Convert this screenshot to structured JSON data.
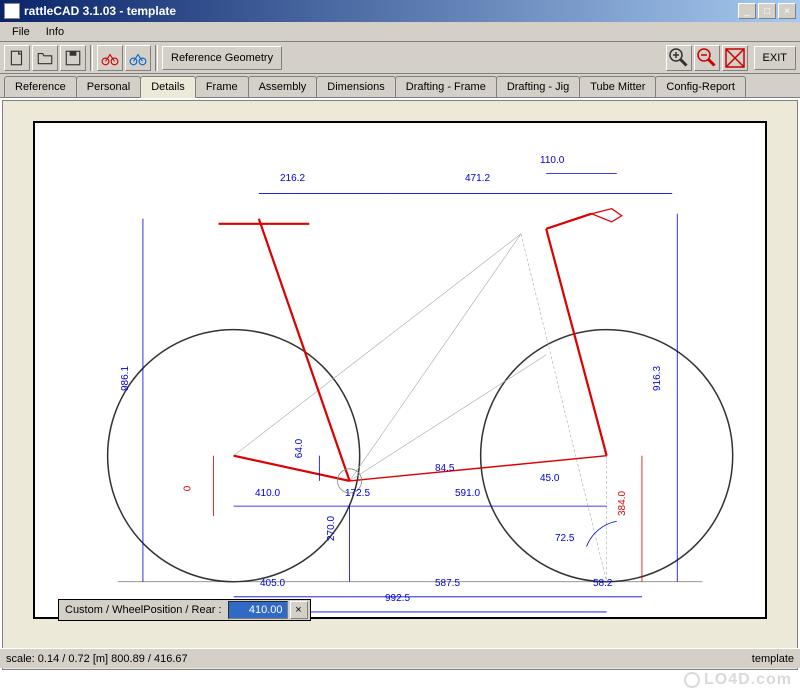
{
  "title": "rattleCAD  3.1.03 - template",
  "menu": {
    "file": "File",
    "info": "Info"
  },
  "toolbar": {
    "ref_geometry": "Reference Geometry",
    "exit": "EXIT"
  },
  "tabs": [
    {
      "label": "Reference",
      "active": false
    },
    {
      "label": "Personal",
      "active": false
    },
    {
      "label": "Details",
      "active": true
    },
    {
      "label": "Frame",
      "active": false
    },
    {
      "label": "Assembly",
      "active": false
    },
    {
      "label": "Dimensions",
      "active": false
    },
    {
      "label": "Drafting - Frame",
      "active": false
    },
    {
      "label": "Drafting - Jig",
      "active": false
    },
    {
      "label": "Tube Mitter",
      "active": false
    },
    {
      "label": "Config-Report",
      "active": false
    }
  ],
  "dimensions": {
    "top_left": "216.2",
    "top_right": "471.2",
    "stem": "110.0",
    "left_height": "986.1",
    "right_height": "916.3",
    "bb_drop": "64.0",
    "chainstay": "410.0",
    "seat_tube_ext": "172.5",
    "front_center": "591.0",
    "fork_offset": "45.0",
    "rear_axle_drop": "0",
    "head_angle": "72.5",
    "bb_ground": "270.0",
    "rear_ground": "405.0",
    "front_ground": "587.5",
    "wheelbase": "992.5",
    "trail": "58.2",
    "reach": "84.5",
    "stack_right": "384.0"
  },
  "input": {
    "label": "Custom / WheelPosition / Rear :",
    "value": "410.00"
  },
  "status": {
    "left": "scale: 0.14 / 0.72  [m]  800.89 / 416.67",
    "right": "template"
  },
  "watermark": "LO4D.com"
}
